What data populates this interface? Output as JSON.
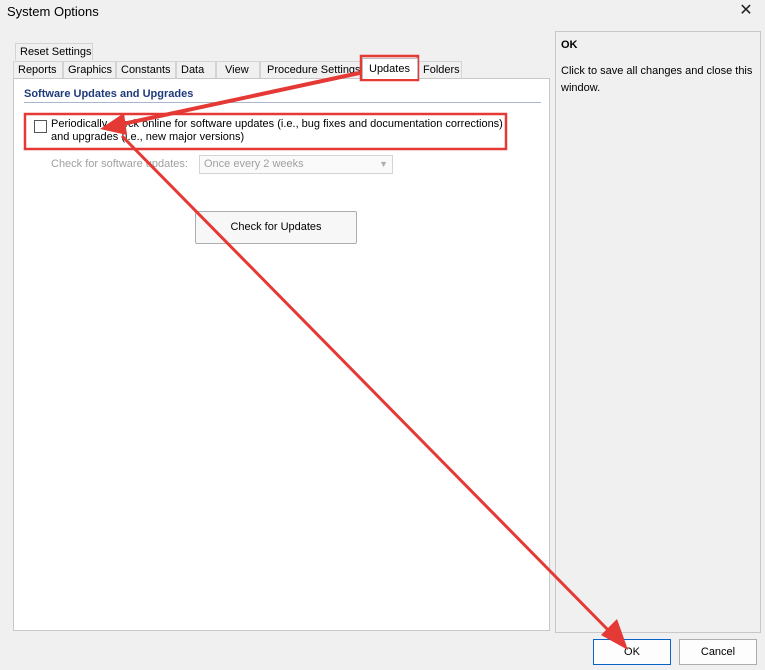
{
  "window": {
    "title": "System Options"
  },
  "tabs_row1": [
    {
      "label": "Reset Settings"
    }
  ],
  "tabs_row2": [
    {
      "label": "Reports"
    },
    {
      "label": "Graphics"
    },
    {
      "label": "Constants"
    },
    {
      "label": "Data"
    },
    {
      "label": "View"
    },
    {
      "label": "Procedure Settings"
    },
    {
      "label": "Updates",
      "active": true
    },
    {
      "label": "Folders"
    }
  ],
  "updates": {
    "section_title": "Software Updates and Upgrades",
    "periodic_check_label": "Periodically check online for software updates (i.e., bug fixes and documentation corrections) and upgrades (i.e., new major versions)",
    "periodic_check_checked": false,
    "frequency_label": "Check for software updates:",
    "frequency_value": "Once every 2 weeks",
    "check_button": "Check for Updates"
  },
  "help": {
    "title": "OK",
    "text": "Click to save all changes and close this window."
  },
  "footer": {
    "ok": "OK",
    "cancel": "Cancel"
  },
  "annotation_color": "#e53935"
}
